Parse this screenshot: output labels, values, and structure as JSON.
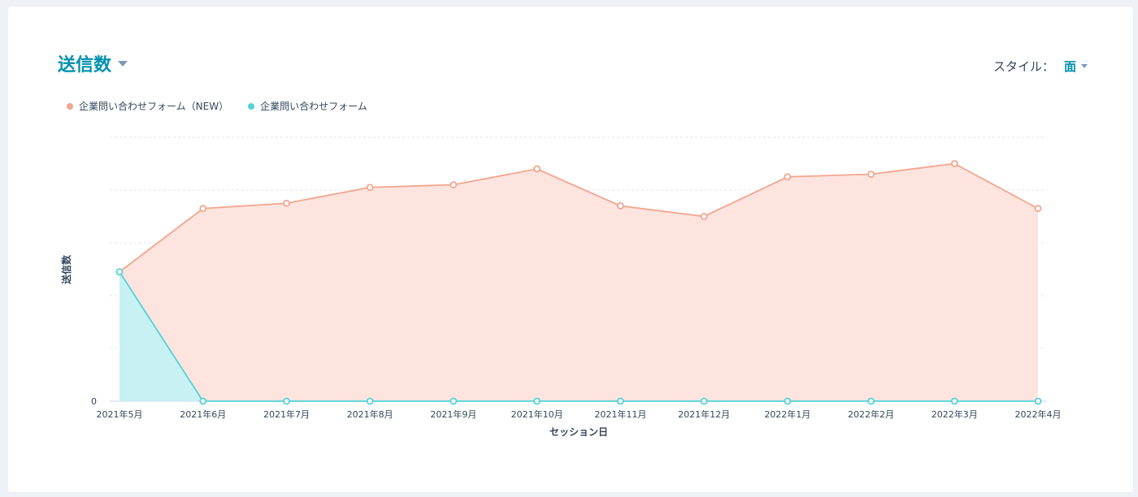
{
  "header": {
    "title": "送信数",
    "style_label": "スタイル：",
    "style_value": "面"
  },
  "chart_data": {
    "type": "area",
    "categories": [
      "2021年5月",
      "2021年6月",
      "2021年7月",
      "2021年8月",
      "2021年9月",
      "2021年10月",
      "2021年11月",
      "2021年12月",
      "2022年1月",
      "2022年2月",
      "2022年3月",
      "2022年4月"
    ],
    "series": [
      {
        "name": "企業問い合わせフォーム（NEW）",
        "color": "#f2a58e",
        "fill": "#fde4df",
        "values": [
          49,
          73,
          75,
          81,
          82,
          88,
          74,
          70,
          85,
          86,
          90,
          73
        ]
      },
      {
        "name": "企業問い合わせフォーム",
        "color": "#51d3d9",
        "fill": "#c8f1f3",
        "values": [
          49,
          0,
          0,
          0,
          0,
          0,
          0,
          0,
          0,
          0,
          0,
          0
        ]
      }
    ],
    "ylabel": "送信数",
    "xlabel": "セッション日",
    "ylim": [
      0,
      100
    ],
    "y_ticks": [
      {
        "value": 0,
        "label": "0"
      },
      {
        "value": 20,
        "label": ""
      },
      {
        "value": 40,
        "label": ""
      },
      {
        "value": 60,
        "label": ""
      },
      {
        "value": 80,
        "label": ""
      },
      {
        "value": 100,
        "label": ""
      }
    ],
    "grid": true,
    "legend": "top-left"
  }
}
